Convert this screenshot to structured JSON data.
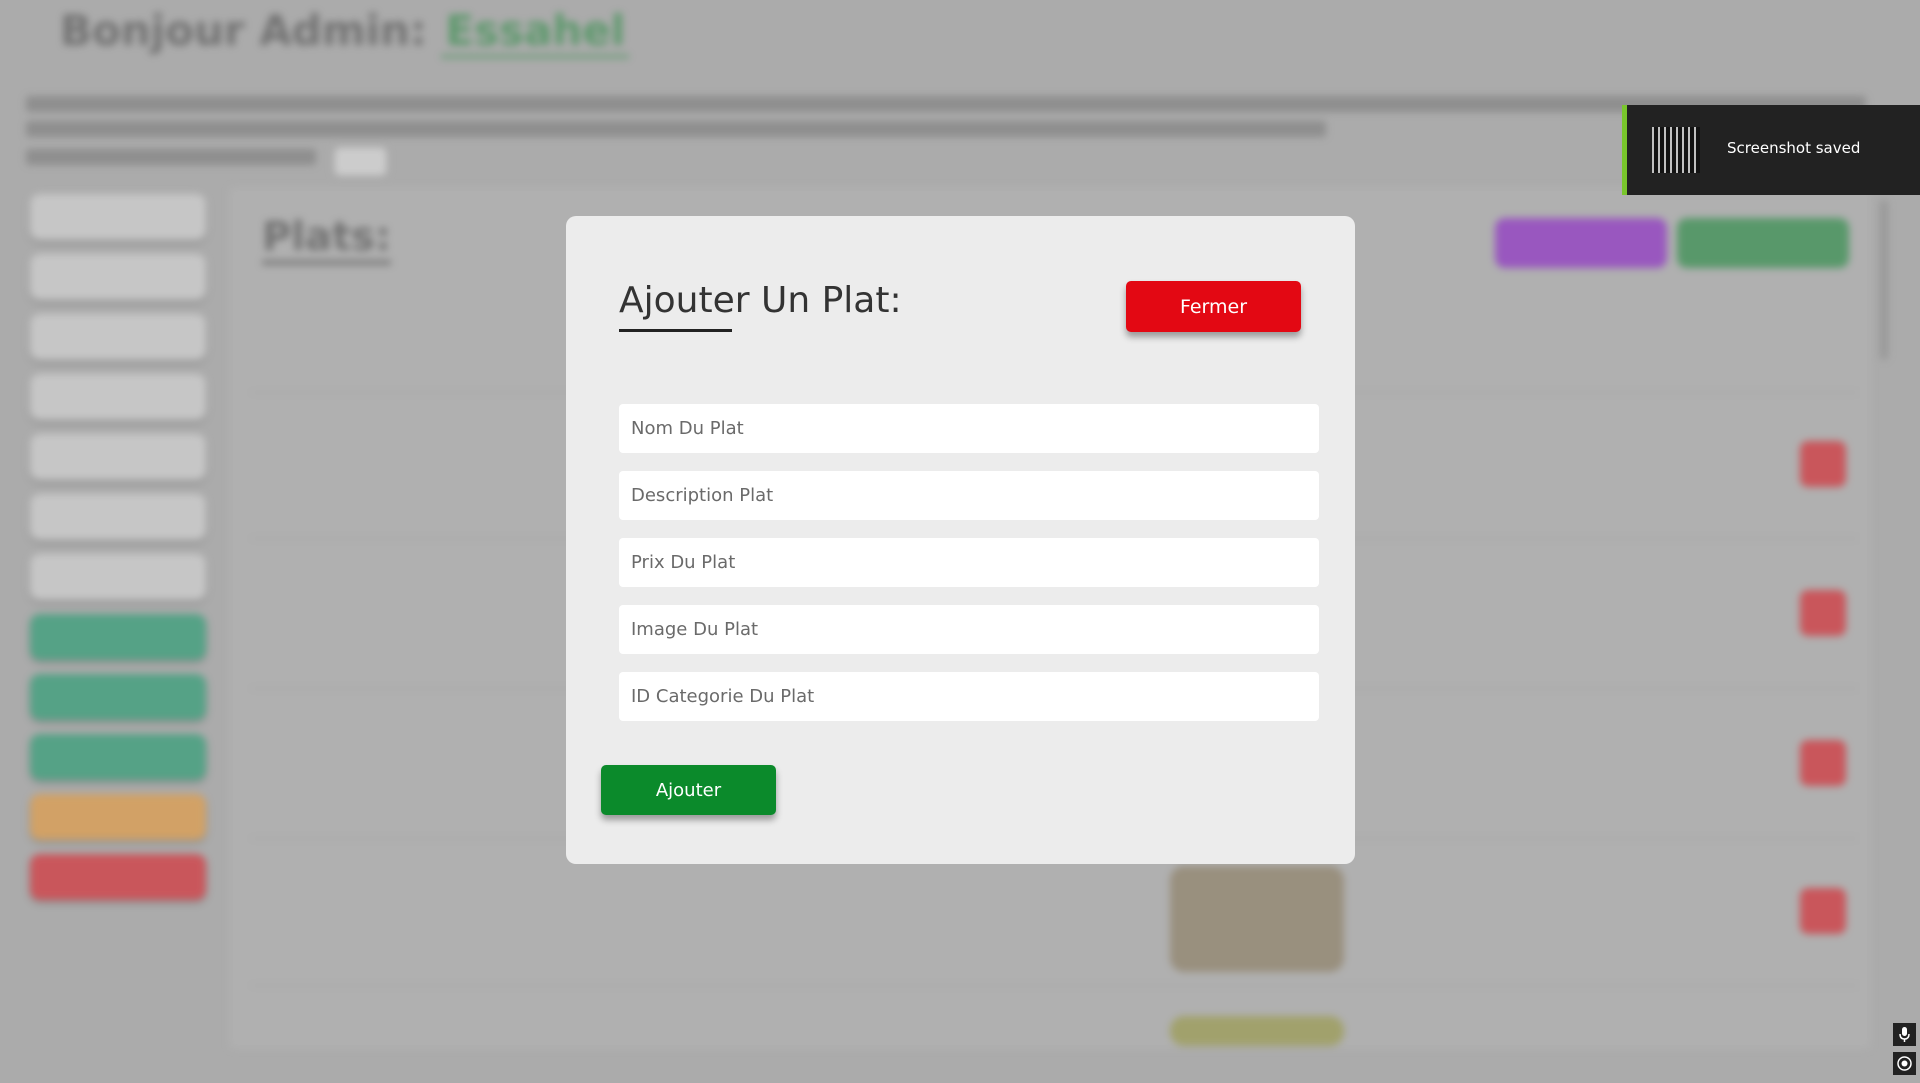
{
  "modal": {
    "title": "Ajouter Un Plat:",
    "close_label": "Fermer",
    "fields": [
      {
        "placeholder": "Nom Du Plat",
        "value": ""
      },
      {
        "placeholder": "Description Plat",
        "value": ""
      },
      {
        "placeholder": "Prix Du Plat",
        "value": ""
      },
      {
        "placeholder": "Image Du Plat",
        "value": ""
      },
      {
        "placeholder": "ID Categorie Du Plat",
        "value": ""
      }
    ],
    "submit_label": "Ajouter"
  },
  "toast": {
    "message": "Screenshot saved"
  },
  "background": {
    "greeting": "Bonjour Admin:",
    "admin_name": "Essahel",
    "page_title": "Plats:"
  },
  "colors": {
    "close_button": "#e30813",
    "submit_button": "#0b8a2b",
    "toast_accent": "#79c62c"
  },
  "icons": {
    "toast_thumbnail": "screenshot-thumbnail-icon",
    "corner_top": "microphone-icon",
    "corner_bottom": "record-icon"
  }
}
